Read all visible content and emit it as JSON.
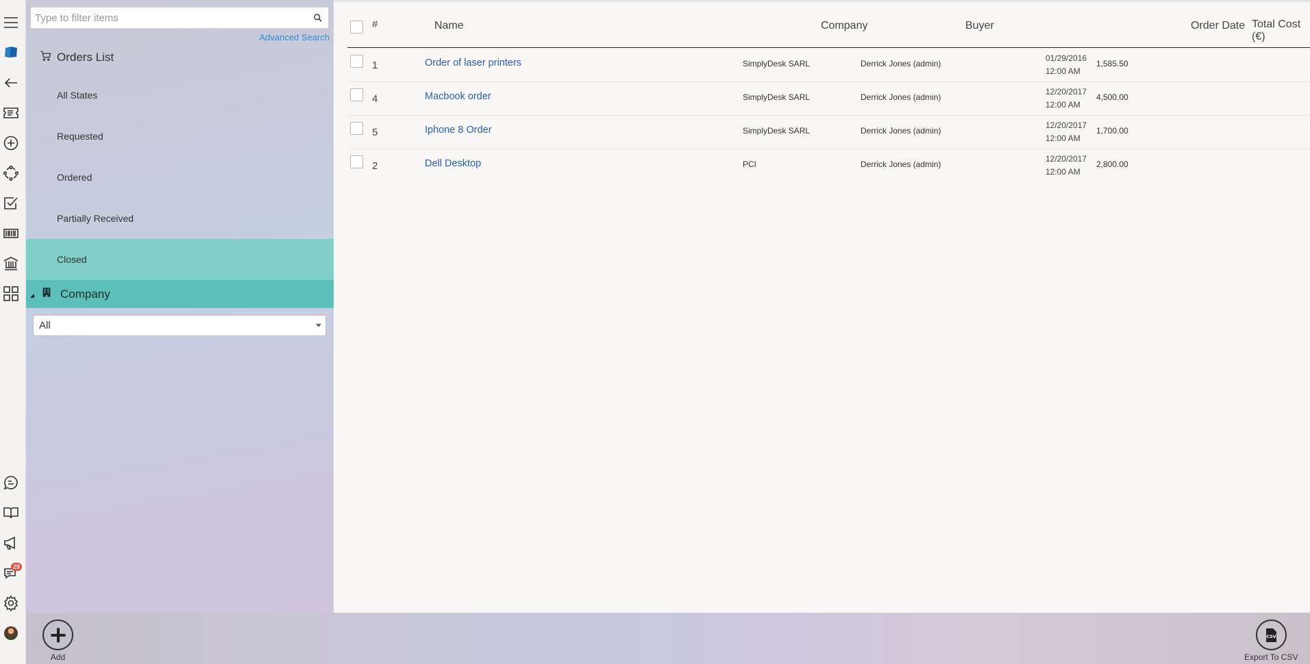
{
  "search": {
    "placeholder": "Type to filter items",
    "advanced_label": "Advanced Search"
  },
  "panel": {
    "title": "Orders List",
    "states": [
      "All States",
      "Requested",
      "Ordered",
      "Partially Received",
      "Closed"
    ],
    "active_state": "Closed",
    "company_section": "Company",
    "company_select_value": "All"
  },
  "table": {
    "headers": {
      "num": "#",
      "name": "Name",
      "company": "Company",
      "buyer": "Buyer",
      "order_date": "Order Date",
      "total_cost": "Total Cost (€)"
    },
    "rows": [
      {
        "num": "1",
        "name": "Order of laser printers",
        "company": "SimplyDesk SARL",
        "buyer": "Derrick Jones (admin)",
        "date": "01/29/2016",
        "time": "12:00 AM",
        "cost": "1,585.50"
      },
      {
        "num": "4",
        "name": "Macbook order",
        "company": "SimplyDesk SARL",
        "buyer": "Derrick Jones (admin)",
        "date": "12/20/2017",
        "time": "12:00 AM",
        "cost": "4,500.00"
      },
      {
        "num": "5",
        "name": "Iphone 8 Order",
        "company": "SimplyDesk SARL",
        "buyer": "Derrick Jones (admin)",
        "date": "12/20/2017",
        "time": "12:00 AM",
        "cost": "1,700.00"
      },
      {
        "num": "2",
        "name": "Dell Desktop",
        "company": "PCI",
        "buyer": "Derrick Jones (admin)",
        "date": "12/20/2017",
        "time": "12:00 AM",
        "cost": "2,800.00"
      }
    ]
  },
  "rail": {
    "icons": [
      "menu-icon",
      "logo-icon",
      "back-arrow-icon",
      "ticket-icon",
      "add-circle-icon",
      "workflow-icon",
      "checklist-icon",
      "barcode-icon",
      "bank-icon",
      "grid-icon"
    ],
    "bottom_icons": [
      "chat-icon",
      "book-icon",
      "megaphone-icon",
      "messages-icon",
      "gear-icon",
      "avatar"
    ],
    "notification_count": "29"
  },
  "bottom_bar": {
    "add_label": "Add",
    "export_label": "Export To CSV",
    "csv_glyph": "CSV"
  },
  "colors": {
    "accent": "#5cbfb9",
    "active_item": "#80cfc8",
    "link": "#2c5fa8",
    "advanced_link": "#2b8fd6",
    "badge": "#e74c3c"
  }
}
